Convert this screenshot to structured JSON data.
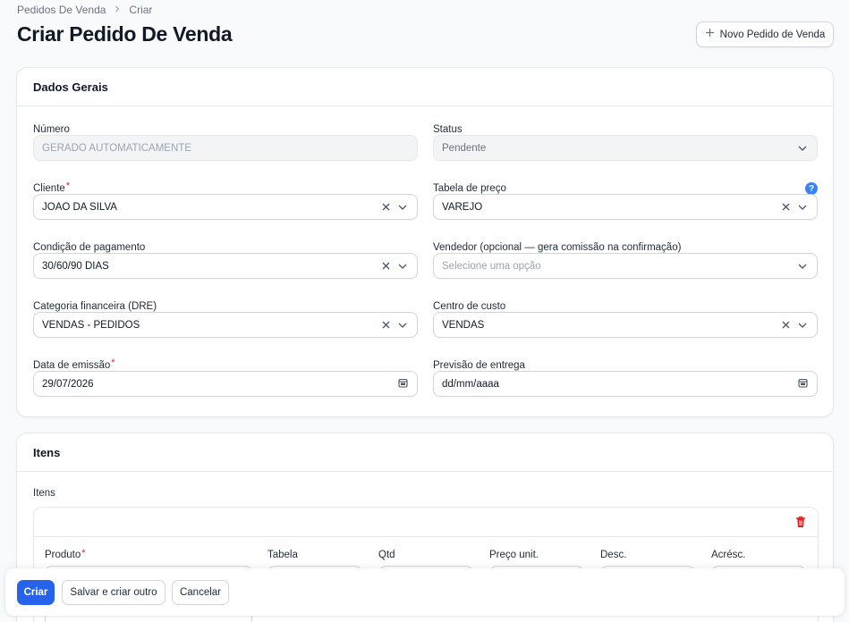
{
  "breadcrumb": {
    "parent": "Pedidos De Venda",
    "current": "Criar"
  },
  "page": {
    "title": "Criar Pedido De Venda"
  },
  "header_action": {
    "label": "Novo Pedido de Venda"
  },
  "dados_gerais": {
    "title": "Dados Gerais",
    "numero": {
      "label": "Número",
      "value": "GERADO AUTOMATICAMENTE"
    },
    "status": {
      "label": "Status",
      "value": "Pendente"
    },
    "cliente": {
      "label": "Cliente",
      "required": "*",
      "value": "JOAO DA SILVA"
    },
    "tabela_preco": {
      "label": "Tabela de preço",
      "value": "VAREJO",
      "help": "?"
    },
    "condicao_pagamento": {
      "label": "Condição de pagamento",
      "value": "30/60/90 DIAS"
    },
    "vendedor": {
      "label": "Vendedor (opcional — gera comissão na confirmação)",
      "placeholder": "Selecione uma opção"
    },
    "categoria_financeira": {
      "label": "Categoria financeira (DRE)",
      "value": "VENDAS - PEDIDOS"
    },
    "centro_custo": {
      "label": "Centro de custo",
      "value": "VENDAS"
    },
    "data_emissao": {
      "label": "Data de emissão",
      "required": "*",
      "value": "29/07/2026"
    },
    "previsao_entrega": {
      "label": "Previsão de entrega",
      "value": "dd/mm/aaaa"
    }
  },
  "itens": {
    "title": "Itens",
    "repeater_label": "Itens",
    "columns": {
      "produto": "Produto",
      "produto_required": "*",
      "tabela": "Tabela",
      "qtd": "Qtd",
      "preco_unit": "Preço unit.",
      "desc": "Desc.",
      "acresc": "Acrésc."
    }
  },
  "footer": {
    "criar": "Criar",
    "salvar_criar_outro": "Salvar e criar outro",
    "cancelar": "Cancelar"
  },
  "colors": {
    "primary": "#2563eb",
    "danger": "#dc2626",
    "help": "#3b82f6"
  }
}
